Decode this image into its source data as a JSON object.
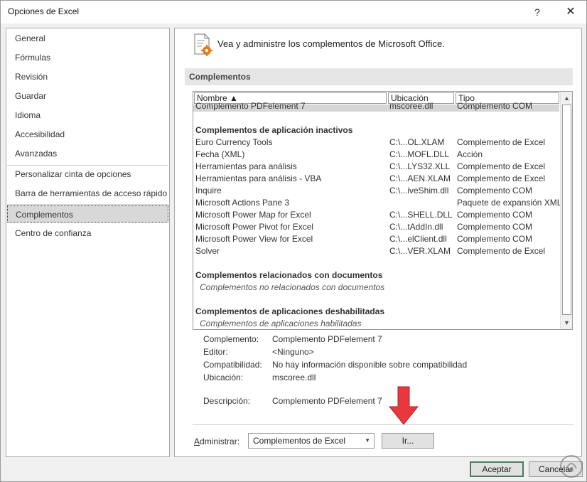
{
  "window": {
    "title": "Opciones de Excel",
    "help_label": "?",
    "close_label": "✕"
  },
  "nav": {
    "items": [
      {
        "label": "General"
      },
      {
        "label": "Fórmulas"
      },
      {
        "label": "Revisión"
      },
      {
        "label": "Guardar"
      },
      {
        "label": "Idioma"
      },
      {
        "label": "Accesibilidad"
      },
      {
        "label": "Avanzadas"
      },
      {
        "label": "Personalizar cinta de opciones"
      },
      {
        "label": "Barra de herramientas de acceso rápido"
      },
      {
        "label": "Complementos"
      },
      {
        "label": "Centro de confianza"
      }
    ],
    "selected": "Complementos"
  },
  "main": {
    "header_text": "Vea y administre los complementos de Microsoft Office.",
    "section_title": "Complementos",
    "columns": {
      "name": "Nombre ▲",
      "location": "Ubicación",
      "type": "Tipo"
    },
    "selected_row": {
      "name": "Complemento PDFelement 7",
      "location": "mscoree.dll",
      "type": "Complemento COM"
    },
    "inactive_group": "Complementos de aplicación inactivos",
    "inactive": [
      {
        "name": "Euro Currency Tools",
        "location": "C:\\...OL.XLAM",
        "type": "Complemento de Excel"
      },
      {
        "name": "Fecha (XML)",
        "location": "C:\\...MOFL.DLL",
        "type": "Acción"
      },
      {
        "name": "Herramientas para análisis",
        "location": "C:\\...LYS32.XLL",
        "type": "Complemento de Excel"
      },
      {
        "name": "Herramientas para análisis - VBA",
        "location": "C:\\...AEN.XLAM",
        "type": "Complemento de Excel"
      },
      {
        "name": "Inquire",
        "location": "C:\\...iveShim.dll",
        "type": "Complemento COM"
      },
      {
        "name": "Microsoft Actions Pane 3",
        "location": "",
        "type": "Paquete de expansión XML"
      },
      {
        "name": "Microsoft Power Map for Excel",
        "location": "C:\\...SHELL.DLL",
        "type": "Complemento COM"
      },
      {
        "name": "Microsoft Power Pivot for Excel",
        "location": "C:\\...tAddIn.dll",
        "type": "Complemento COM"
      },
      {
        "name": "Microsoft Power View for Excel",
        "location": "C:\\...elClient.dll",
        "type": "Complemento COM"
      },
      {
        "name": "Solver",
        "location": "C:\\...VER.XLAM",
        "type": "Complemento de Excel"
      }
    ],
    "doc_group": "Complementos relacionados con documentos",
    "doc_empty": "Complementos no relacionados con documentos",
    "disabled_group": "Complementos de aplicaciones deshabilitadas",
    "disabled_empty": "Complementos de aplicaciones habilitadas",
    "details": {
      "complement_label": "Complemento:",
      "complement_value": "Complemento PDFelement 7",
      "editor_label": "Editor:",
      "editor_value": "<Ninguno>",
      "compat_label": "Compatibilidad:",
      "compat_value": "No hay información disponible sobre compatibilidad",
      "location_label": "Ubicación:",
      "location_value": "mscoree.dll",
      "description_label": "Descripción:",
      "description_value": "Complemento PDFelement 7"
    },
    "manage": {
      "label_prefix": "A",
      "label_rest": "dministrar:",
      "selected_value": "Complementos de Excel",
      "go_label": "Ir..."
    }
  },
  "footer": {
    "ok_label": "Aceptar",
    "cancel_label": "Cancelar"
  },
  "colors": {
    "arrow": "#e8383d",
    "selected_nav": "#d8d8d8",
    "ok_border": "#4a7c59"
  }
}
